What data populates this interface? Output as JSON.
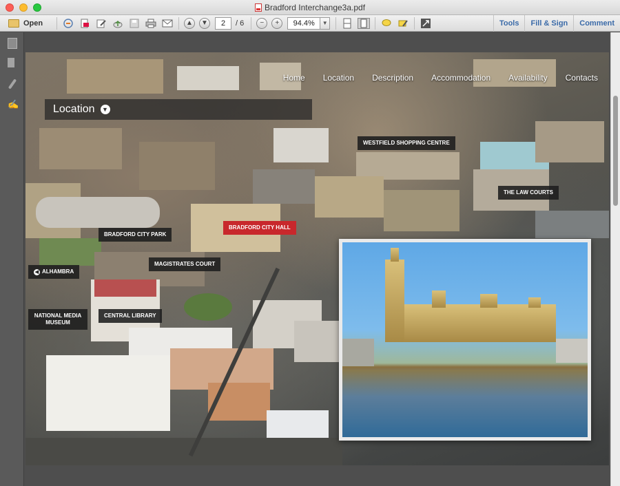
{
  "window": {
    "title": "Bradford Interchange3a.pdf"
  },
  "toolbar": {
    "open_label": "Open",
    "page_current": "2",
    "page_total": "/ 6",
    "zoom": "94.4%",
    "tools_label": "Tools",
    "fill_sign_label": "Fill & Sign",
    "comment_label": "Comment"
  },
  "document": {
    "nav": [
      "Home",
      "Location",
      "Description",
      "Accommodation",
      "Availability",
      "Contacts"
    ],
    "section_title": "Location",
    "labels": {
      "westfield": "WESTFIELD SHOPPING CENTRE",
      "law_courts": "THE LAW COURTS",
      "city_hall": "BRADFORD CITY HALL",
      "city_park": "BRADFORD CITY PARK",
      "magistrates": "MAGISTRATES COURT",
      "alhambra": "ALHAMBRA",
      "media_museum": "NATIONAL MEDIA MUSEUM",
      "central_library": "CENTRAL LIBRARY"
    }
  }
}
